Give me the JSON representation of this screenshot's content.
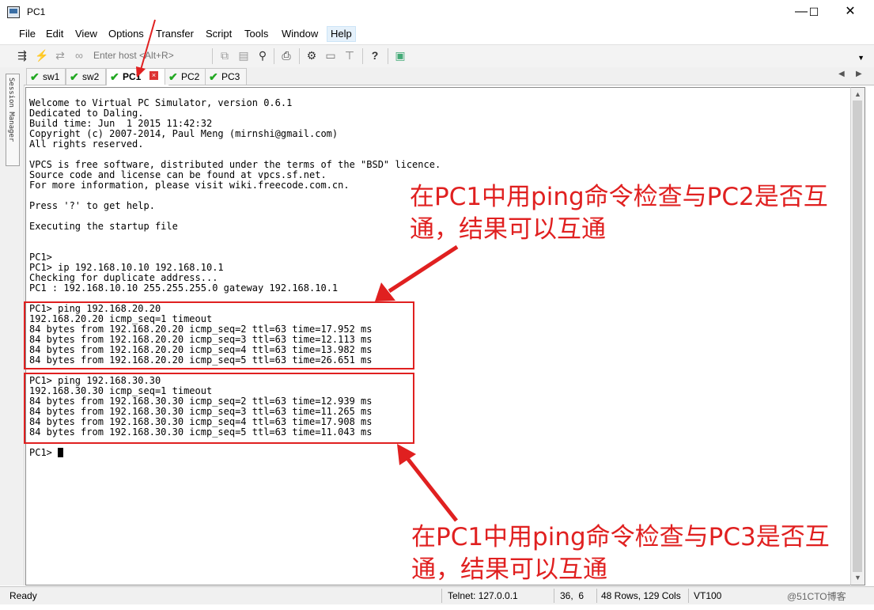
{
  "window": {
    "title": "PC1",
    "minimize": "—",
    "maximize": "☐",
    "close": "✕"
  },
  "menu": [
    "File",
    "Edit",
    "View",
    "Options",
    "Transfer",
    "Script",
    "Tools",
    "Window",
    "Help"
  ],
  "toolbar": {
    "host_placeholder": "Enter host <Alt+R>"
  },
  "session_manager": {
    "label": "Session Manager"
  },
  "tabs": [
    {
      "label": "sw1",
      "active": false
    },
    {
      "label": "sw2",
      "active": false
    },
    {
      "label": "PC1",
      "active": true
    },
    {
      "label": "PC2",
      "active": false
    },
    {
      "label": "PC3",
      "active": false
    }
  ],
  "terminal": {
    "lines": [
      "Welcome to Virtual PC Simulator, version 0.6.1",
      "Dedicated to Daling.",
      "Build time: Jun  1 2015 11:42:32",
      "Copyright (c) 2007-2014, Paul Meng (mirnshi@gmail.com)",
      "All rights reserved.",
      "",
      "VPCS is free software, distributed under the terms of the \"BSD\" licence.",
      "Source code and license can be found at vpcs.sf.net.",
      "For more information, please visit wiki.freecode.com.cn.",
      "",
      "Press '?' to get help.",
      "",
      "Executing the startup file",
      "",
      "",
      "PC1>",
      "PC1> ip 192.168.10.10 192.168.10.1",
      "Checking for duplicate address...",
      "PC1 : 192.168.10.10 255.255.255.0 gateway 192.168.10.1",
      "",
      "PC1> ping 192.168.20.20",
      "192.168.20.20 icmp_seq=1 timeout",
      "84 bytes from 192.168.20.20 icmp_seq=2 ttl=63 time=17.952 ms",
      "84 bytes from 192.168.20.20 icmp_seq=3 ttl=63 time=12.113 ms",
      "84 bytes from 192.168.20.20 icmp_seq=4 ttl=63 time=13.982 ms",
      "84 bytes from 192.168.20.20 icmp_seq=5 ttl=63 time=26.651 ms",
      "",
      "PC1> ping 192.168.30.30",
      "192.168.30.30 icmp_seq=1 timeout",
      "84 bytes from 192.168.30.30 icmp_seq=2 ttl=63 time=12.939 ms",
      "84 bytes from 192.168.30.30 icmp_seq=3 ttl=63 time=11.265 ms",
      "84 bytes from 192.168.30.30 icmp_seq=4 ttl=63 time=17.908 ms",
      "84 bytes from 192.168.30.30 icmp_seq=5 ttl=63 time=11.043 ms",
      ""
    ],
    "prompt": "PC1> "
  },
  "annotations": {
    "top_line1": "在PC1中用ping命令检查与PC2是否互",
    "top_line2": "通，结果可以互通",
    "bottom_line1": "在PC1中用ping命令检查与PC3是否互",
    "bottom_line2": "通，结果可以互通",
    "color": "#e02020"
  },
  "status": {
    "ready": "Ready",
    "connection": "Telnet: 127.0.0.1",
    "cursor_pos": "36,  6",
    "size": "48 Rows, 129 Cols",
    "emulation": "VT100",
    "watermark": "@51CTO博客"
  }
}
